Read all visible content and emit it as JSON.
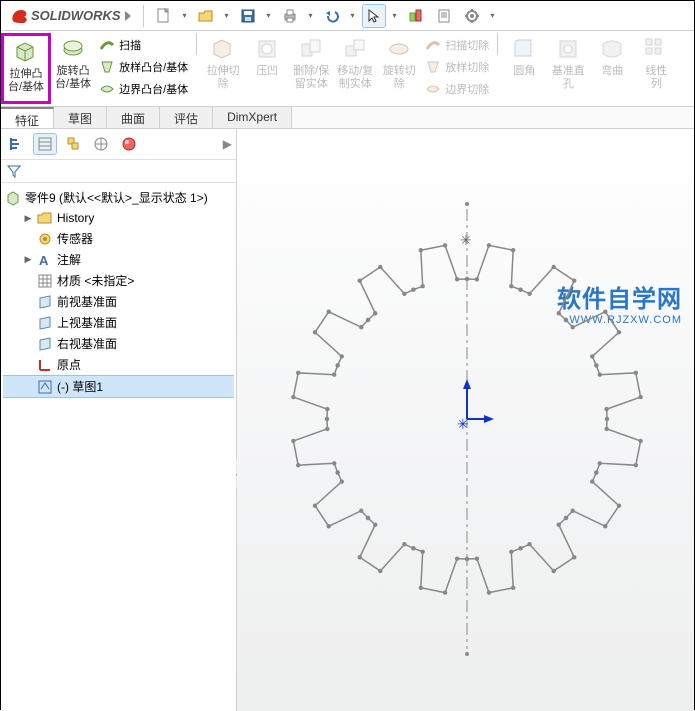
{
  "app": {
    "name": "SOLIDWORKS"
  },
  "topbar": {
    "new": "new",
    "open": "open",
    "save": "save",
    "print": "print",
    "undo": "undo",
    "select": "select",
    "rebuild": "rebuild",
    "options": "options",
    "settings": "settings"
  },
  "ribbon": {
    "extrude": "拉伸凸\n台/基体",
    "revolve": "旋转凸\n台/基体",
    "sweep": "扫描",
    "loft": "放样凸台/基体",
    "boundary": "边界凸台/基体",
    "extruded_cut": "拉伸切\n除",
    "hole": "压凹",
    "delete_keep": "删除/保\n留实体",
    "move_copy": "移动/复\n制实体",
    "rev_cut": "旋转切\n除",
    "swept_cut": "扫描切除",
    "lofted_cut": "放样切除",
    "boundary_cut": "边界切除",
    "fillet": "圆角",
    "slot": "基准直\n孔",
    "wrap": "弯曲",
    "linear_pattern": "线性\n列"
  },
  "tabs": {
    "features": "特征",
    "sketch": "草图",
    "surfaces": "曲面",
    "evaluate": "评估",
    "dimxpert": "DimXpert"
  },
  "viewtools": [
    "zoom-to-fit",
    "zoom-area",
    "prev-view",
    "section-view"
  ],
  "tree": {
    "root": "零件9  (默认<<默认>_显示状态 1>)",
    "history": "History",
    "sensors": "传感器",
    "annotations": "注解",
    "material": "材质 <未指定>",
    "front": "前视基准面",
    "top": "上视基准面",
    "right": "右视基准面",
    "origin": "原点",
    "sketch1": "(-) 草图1"
  },
  "watermark": {
    "cn": "软件自学网",
    "en": "WWW.RJZXW.COM"
  },
  "colors": {
    "highlight": "#c800c8",
    "brand": "#d52b1e"
  }
}
